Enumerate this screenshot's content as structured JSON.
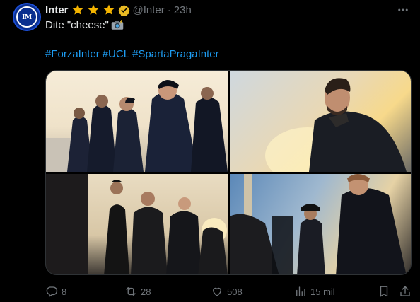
{
  "post": {
    "author": "Inter",
    "handle": "@Inter",
    "separator": "·",
    "time": "23h",
    "avatar_text": "IM",
    "text": "Dite \"cheese\"",
    "hashtags": [
      "#ForzaInter",
      "#UCL",
      "#SpartaPragaInter"
    ],
    "badges": [
      "star-icon",
      "star-icon",
      "star-icon",
      "verified-icon"
    ],
    "colors": {
      "accent": "#1d9bf0",
      "muted": "#71767b",
      "gold": "#f4b400",
      "background": "#000000"
    }
  },
  "actions": {
    "replies": "8",
    "reposts": "28",
    "likes": "508",
    "views": "15 mil"
  }
}
